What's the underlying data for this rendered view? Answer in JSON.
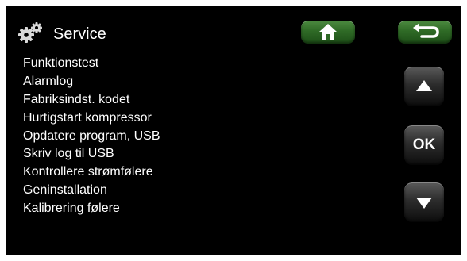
{
  "header": {
    "title": "Service",
    "icon": "gears-icon"
  },
  "toolbar": {
    "home_icon": "home-icon",
    "back_icon": "back-arrow-icon",
    "accent": "#2f6a26"
  },
  "menu": {
    "items": [
      {
        "label": "Funktionstest"
      },
      {
        "label": "Alarmlog"
      },
      {
        "label": "Fabriksindst. kodet"
      },
      {
        "label": "Hurtigstart kompressor"
      },
      {
        "label": "Opdatere program, USB"
      },
      {
        "label": "Skriv log til USB"
      },
      {
        "label": "Kontrollere strømfølere"
      },
      {
        "label": "Geninstallation"
      },
      {
        "label": "Kalibrering følere"
      }
    ]
  },
  "nav": {
    "up_icon": "arrow-up-icon",
    "ok_label": "OK",
    "down_icon": "arrow-down-icon"
  }
}
